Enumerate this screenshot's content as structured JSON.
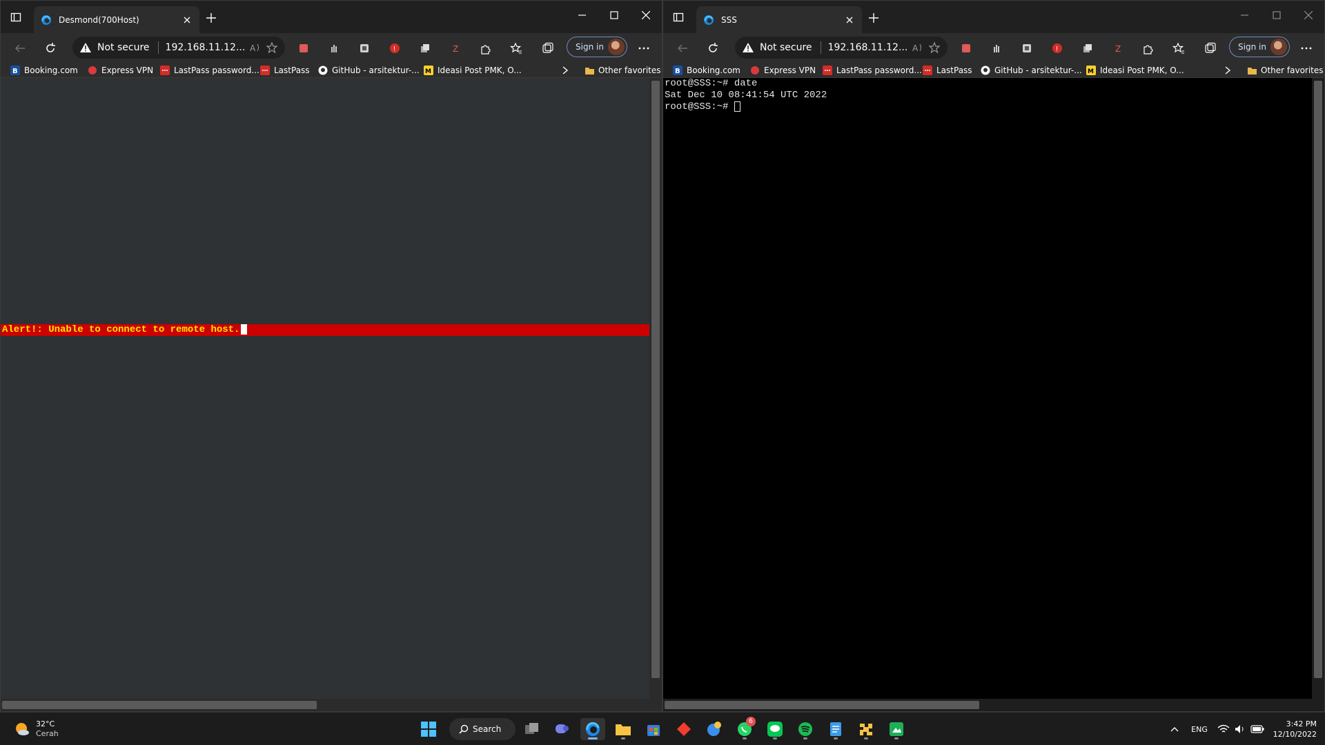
{
  "left_window": {
    "tab_title": "Desmond(700Host)",
    "address": {
      "security_label": "Not secure",
      "url": "192.168.11.12..."
    },
    "sign_in_label": "Sign in",
    "alert_text": "Alert!: Unable to connect to remote host."
  },
  "right_window": {
    "tab_title": "SSS",
    "address": {
      "security_label": "Not secure",
      "url": "192.168.11.12..."
    },
    "sign_in_label": "Sign in",
    "terminal_lines": [
      "root@SSS:~# date",
      "Sat Dec 10 08:41:54 UTC 2022",
      "root@SSS:~# "
    ]
  },
  "bookmarks": [
    {
      "label": "Booking.com",
      "icon": "booking-icon",
      "color": "#1a4fa0"
    },
    {
      "label": "Express VPN",
      "icon": "expressvpn-icon",
      "color": "#da3940"
    },
    {
      "label": "LastPass password...",
      "icon": "lastpass-icon",
      "color": "#d32d27"
    },
    {
      "label": "LastPass",
      "icon": "lastpass-icon",
      "color": "#d32d27"
    },
    {
      "label": "GitHub - arsitektur-...",
      "icon": "github-icon",
      "color": "#ffffff"
    },
    {
      "label": "Ideasi Post PMK, O...",
      "icon": "miro-icon",
      "color": "#ffd02f"
    }
  ],
  "bookmarks_other": "Other favorites",
  "taskbar": {
    "weather_temp": "32°C",
    "weather_condition": "Cerah",
    "search_label": "Search",
    "whatsapp_badge": "6",
    "language": "ENG",
    "time": "3:42 PM",
    "date": "12/10/2022"
  },
  "colors": {
    "alert_bg": "#cc0000",
    "alert_text": "#ffe600",
    "terminal_bg": "#000000",
    "left_content_bg": "#2f3234"
  }
}
